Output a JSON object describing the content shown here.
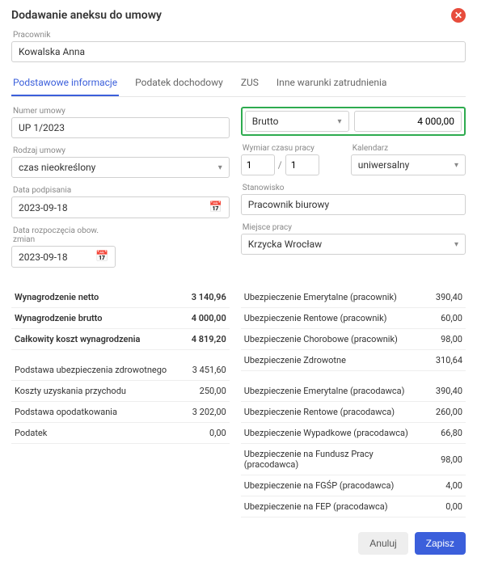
{
  "modal": {
    "title": "Dodawanie aneksu do umowy"
  },
  "employee": {
    "label": "Pracownik",
    "value": "Kowalska Anna"
  },
  "tabs": {
    "t1": "Podstawowe informacje",
    "t2": "Podatek dochodowy",
    "t3": "ZUS",
    "t4": "Inne warunki zatrudnienia"
  },
  "left": {
    "numer_label": "Numer umowy",
    "numer_value": "UP 1/2023",
    "rodzaj_label": "Rodzaj umowy",
    "rodzaj_value": "czas nieokreślony",
    "podpisania_label": "Data podpisania",
    "podpisania_value": "2023-09-18",
    "rozpoczecia_label": "Data rozpoczęcia obow. zmian",
    "rozpoczecia_value": "2023-09-18"
  },
  "right": {
    "brutto_label": "Brutto",
    "brutto_value": "4 000,00",
    "wymiar_label": "Wymiar czasu pracy",
    "wymiar_a": "1",
    "wymiar_b": "1",
    "kal_label": "Kalendarz",
    "kal_value": "uniwersalny",
    "stan_label": "Stanowisko",
    "stan_value": "Pracownik biurowy",
    "miejsce_label": "Miejsce pracy",
    "miejsce_value": "Krzycka Wrocław"
  },
  "sum_left": {
    "r1l": "Wynagrodzenie netto",
    "r1v": "3 140,96",
    "r2l": "Wynagrodzenie brutto",
    "r2v": "4 000,00",
    "r3l": "Całkowity koszt wynagrodzenia",
    "r3v": "4 819,20",
    "r4l": "Podstawa ubezpieczenia zdrowotnego",
    "r4v": "3 451,60",
    "r5l": "Koszty uzyskania przychodu",
    "r5v": "250,00",
    "r6l": "Podstawa opodatkowania",
    "r6v": "3 202,00",
    "r7l": "Podatek",
    "r7v": "0,00"
  },
  "sum_right": {
    "r1l": "Ubezpieczenie Emerytalne (pracownik)",
    "r1v": "390,40",
    "r2l": "Ubezpieczenie Rentowe (pracownik)",
    "r2v": "60,00",
    "r3l": "Ubezpieczenie Chorobowe (pracownik)",
    "r3v": "98,00",
    "r4l": "Ubezpieczenie Zdrowotne",
    "r4v": "310,64",
    "r5l": "Ubezpieczenie Emerytalne (pracodawca)",
    "r5v": "390,40",
    "r6l": "Ubezpieczenie Rentowe (pracodawca)",
    "r6v": "260,00",
    "r7l": "Ubezpieczenie Wypadkowe (pracodawca)",
    "r7v": "66,80",
    "r8l": "Ubezpieczenie na Fundusz Pracy (pracodawca)",
    "r8v": "98,00",
    "r9l": "Ubezpieczenie na FGŚP (pracodawca)",
    "r9v": "4,00",
    "r10l": "Ubezpieczenie na FEP (pracodawca)",
    "r10v": "0,00"
  },
  "footer": {
    "cancel": "Anuluj",
    "save": "Zapisz"
  }
}
